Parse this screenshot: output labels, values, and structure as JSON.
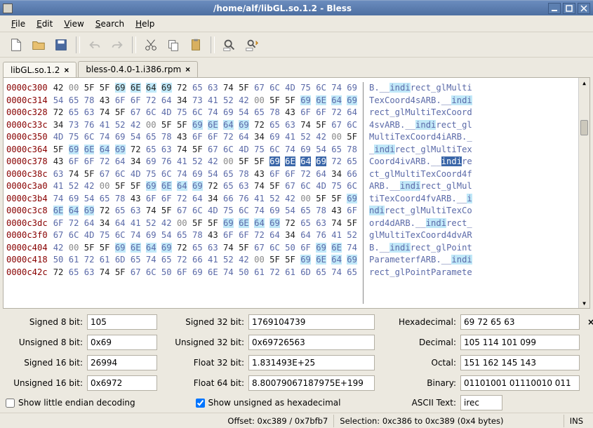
{
  "title": "/home/alf/libGL.so.1.2 - Bless",
  "menus": {
    "file": "File",
    "edit": "Edit",
    "view": "View",
    "search": "Search",
    "help": "Help"
  },
  "tabs": [
    {
      "label": "libGL.so.1.2",
      "closable": true,
      "active": true
    },
    {
      "label": "bless-0.4.0-1.i386.rpm",
      "closable": true,
      "active": false
    }
  ],
  "hex": {
    "offsets": [
      "0000c300",
      "0000c314",
      "0000c328",
      "0000c33c",
      "0000c350",
      "0000c364",
      "0000c378",
      "0000c38c",
      "0000c3a0",
      "0000c3b4",
      "0000c3c8",
      "0000c3dc",
      "0000c3f0",
      "0000c404",
      "0000c418",
      "0000c42c"
    ],
    "rows": [
      [
        [
          "42",
          1
        ],
        [
          "00",
          0
        ],
        [
          "5F",
          1
        ],
        [
          "5F",
          1
        ],
        [
          "69",
          1,
          "hl"
        ],
        [
          "6E",
          1,
          "hl"
        ],
        [
          "64",
          1,
          "hl"
        ],
        [
          "69",
          1,
          "hl"
        ],
        [
          "72",
          1
        ],
        [
          "65",
          2
        ],
        [
          "63",
          2
        ],
        [
          "74",
          1
        ],
        [
          "5F",
          1
        ],
        [
          "67",
          2
        ],
        [
          "6C",
          2
        ],
        [
          "4D",
          2
        ],
        [
          "75",
          2
        ],
        [
          "6C",
          2
        ],
        [
          "74",
          2
        ],
        [
          "69",
          2
        ]
      ],
      [
        [
          "54",
          2
        ],
        [
          "65",
          2
        ],
        [
          "78",
          2
        ],
        [
          "43",
          1
        ],
        [
          "6F",
          2
        ],
        [
          "6F",
          2
        ],
        [
          "72",
          2
        ],
        [
          "64",
          2
        ],
        [
          "34",
          1
        ],
        [
          "73",
          2
        ],
        [
          "41",
          2
        ],
        [
          "52",
          2
        ],
        [
          "42",
          2
        ],
        [
          "00",
          0
        ],
        [
          "5F",
          1
        ],
        [
          "5F",
          1
        ],
        [
          "69",
          2,
          "hl"
        ],
        [
          "6E",
          2,
          "hl"
        ],
        [
          "64",
          2,
          "hl"
        ],
        [
          "69",
          2,
          "hl"
        ]
      ],
      [
        [
          "72",
          1
        ],
        [
          "65",
          2
        ],
        [
          "63",
          2
        ],
        [
          "74",
          1
        ],
        [
          "5F",
          1
        ],
        [
          "67",
          2
        ],
        [
          "6C",
          2
        ],
        [
          "4D",
          2
        ],
        [
          "75",
          2
        ],
        [
          "6C",
          2
        ],
        [
          "74",
          2
        ],
        [
          "69",
          2
        ],
        [
          "54",
          2
        ],
        [
          "65",
          2
        ],
        [
          "78",
          2
        ],
        [
          "43",
          1
        ],
        [
          "6F",
          2
        ],
        [
          "6F",
          2
        ],
        [
          "72",
          2
        ],
        [
          "64",
          2
        ]
      ],
      [
        [
          "34",
          1
        ],
        [
          "73",
          2
        ],
        [
          "76",
          2
        ],
        [
          "41",
          2
        ],
        [
          "52",
          2
        ],
        [
          "42",
          2
        ],
        [
          "00",
          0
        ],
        [
          "5F",
          1
        ],
        [
          "5F",
          1
        ],
        [
          "69",
          2,
          "hl"
        ],
        [
          "6E",
          2,
          "hl"
        ],
        [
          "64",
          2,
          "hl"
        ],
        [
          "69",
          2,
          "hl"
        ],
        [
          "72",
          1
        ],
        [
          "65",
          2
        ],
        [
          "63",
          2
        ],
        [
          "74",
          1
        ],
        [
          "5F",
          1
        ],
        [
          "67",
          2
        ],
        [
          "6C",
          2
        ]
      ],
      [
        [
          "4D",
          2
        ],
        [
          "75",
          2
        ],
        [
          "6C",
          2
        ],
        [
          "74",
          2
        ],
        [
          "69",
          2
        ],
        [
          "54",
          2
        ],
        [
          "65",
          2
        ],
        [
          "78",
          2
        ],
        [
          "43",
          1
        ],
        [
          "6F",
          2
        ],
        [
          "6F",
          2
        ],
        [
          "72",
          2
        ],
        [
          "64",
          2
        ],
        [
          "34",
          1
        ],
        [
          "69",
          2
        ],
        [
          "41",
          2
        ],
        [
          "52",
          2
        ],
        [
          "42",
          2
        ],
        [
          "00",
          0
        ],
        [
          "5F",
          1
        ]
      ],
      [
        [
          "5F",
          1
        ],
        [
          "69",
          2,
          "hl"
        ],
        [
          "6E",
          2,
          "hl"
        ],
        [
          "64",
          2,
          "hl"
        ],
        [
          "69",
          2,
          "hl"
        ],
        [
          "72",
          1
        ],
        [
          "65",
          2
        ],
        [
          "63",
          2
        ],
        [
          "74",
          1
        ],
        [
          "5F",
          1
        ],
        [
          "67",
          2
        ],
        [
          "6C",
          2
        ],
        [
          "4D",
          2
        ],
        [
          "75",
          2
        ],
        [
          "6C",
          2
        ],
        [
          "74",
          2
        ],
        [
          "69",
          2
        ],
        [
          "54",
          2
        ],
        [
          "65",
          2
        ],
        [
          "78",
          2
        ]
      ],
      [
        [
          "43",
          1
        ],
        [
          "6F",
          2
        ],
        [
          "6F",
          2
        ],
        [
          "72",
          2
        ],
        [
          "64",
          2
        ],
        [
          "34",
          1
        ],
        [
          "69",
          2
        ],
        [
          "76",
          2
        ],
        [
          "41",
          2
        ],
        [
          "52",
          2
        ],
        [
          "42",
          2
        ],
        [
          "00",
          0
        ],
        [
          "5F",
          1
        ],
        [
          "5F",
          1
        ],
        [
          "69",
          2,
          "sel"
        ],
        [
          "6E",
          2,
          "sel"
        ],
        [
          "64",
          2,
          "sel"
        ],
        [
          "69",
          2,
          "sel"
        ],
        [
          "72",
          2
        ],
        [
          "65",
          2
        ]
      ],
      [
        [
          "63",
          2
        ],
        [
          "74",
          1
        ],
        [
          "5F",
          1
        ],
        [
          "67",
          2
        ],
        [
          "6C",
          2
        ],
        [
          "4D",
          2
        ],
        [
          "75",
          2
        ],
        [
          "6C",
          2
        ],
        [
          "74",
          2
        ],
        [
          "69",
          2
        ],
        [
          "54",
          2
        ],
        [
          "65",
          2
        ],
        [
          "78",
          2
        ],
        [
          "43",
          1
        ],
        [
          "6F",
          2
        ],
        [
          "6F",
          2
        ],
        [
          "72",
          2
        ],
        [
          "64",
          2
        ],
        [
          "34",
          1
        ],
        [
          "66",
          2
        ]
      ],
      [
        [
          "41",
          2
        ],
        [
          "52",
          2
        ],
        [
          "42",
          2
        ],
        [
          "00",
          0
        ],
        [
          "5F",
          1
        ],
        [
          "5F",
          1
        ],
        [
          "69",
          2,
          "hl"
        ],
        [
          "6E",
          2,
          "hl"
        ],
        [
          "64",
          2,
          "hl"
        ],
        [
          "69",
          2,
          "hl"
        ],
        [
          "72",
          1
        ],
        [
          "65",
          2
        ],
        [
          "63",
          2
        ],
        [
          "74",
          1
        ],
        [
          "5F",
          1
        ],
        [
          "67",
          2
        ],
        [
          "6C",
          2
        ],
        [
          "4D",
          2
        ],
        [
          "75",
          2
        ],
        [
          "6C",
          2
        ]
      ],
      [
        [
          "74",
          2
        ],
        [
          "69",
          2
        ],
        [
          "54",
          2
        ],
        [
          "65",
          2
        ],
        [
          "78",
          2
        ],
        [
          "43",
          1
        ],
        [
          "6F",
          2
        ],
        [
          "6F",
          2
        ],
        [
          "72",
          2
        ],
        [
          "64",
          2
        ],
        [
          "34",
          1
        ],
        [
          "66",
          2
        ],
        [
          "76",
          2
        ],
        [
          "41",
          2
        ],
        [
          "52",
          2
        ],
        [
          "42",
          2
        ],
        [
          "00",
          0
        ],
        [
          "5F",
          1
        ],
        [
          "5F",
          1
        ],
        [
          "69",
          2,
          "hl"
        ]
      ],
      [
        [
          "6E",
          2,
          "hl"
        ],
        [
          "64",
          2,
          "hl"
        ],
        [
          "69",
          2,
          "hl"
        ],
        [
          "72",
          1
        ],
        [
          "65",
          2
        ],
        [
          "63",
          2
        ],
        [
          "74",
          1
        ],
        [
          "5F",
          1
        ],
        [
          "67",
          2
        ],
        [
          "6C",
          2
        ],
        [
          "4D",
          2
        ],
        [
          "75",
          2
        ],
        [
          "6C",
          2
        ],
        [
          "74",
          2
        ],
        [
          "69",
          2
        ],
        [
          "54",
          2
        ],
        [
          "65",
          2
        ],
        [
          "78",
          2
        ],
        [
          "43",
          1
        ],
        [
          "6F",
          2
        ]
      ],
      [
        [
          "6F",
          2
        ],
        [
          "72",
          2
        ],
        [
          "64",
          2
        ],
        [
          "34",
          1
        ],
        [
          "64",
          2
        ],
        [
          "41",
          2
        ],
        [
          "52",
          2
        ],
        [
          "42",
          2
        ],
        [
          "00",
          0
        ],
        [
          "5F",
          1
        ],
        [
          "5F",
          1
        ],
        [
          "69",
          2,
          "hl"
        ],
        [
          "6E",
          2,
          "hl"
        ],
        [
          "64",
          2,
          "hl"
        ],
        [
          "69",
          2,
          "hl"
        ],
        [
          "72",
          1
        ],
        [
          "65",
          2
        ],
        [
          "63",
          2
        ],
        [
          "74",
          1
        ],
        [
          "5F",
          1
        ]
      ],
      [
        [
          "67",
          2
        ],
        [
          "6C",
          2
        ],
        [
          "4D",
          2
        ],
        [
          "75",
          2
        ],
        [
          "6C",
          2
        ],
        [
          "74",
          2
        ],
        [
          "69",
          2
        ],
        [
          "54",
          2
        ],
        [
          "65",
          2
        ],
        [
          "78",
          2
        ],
        [
          "43",
          1
        ],
        [
          "6F",
          2
        ],
        [
          "6F",
          2
        ],
        [
          "72",
          2
        ],
        [
          "64",
          2
        ],
        [
          "34",
          1
        ],
        [
          "64",
          2
        ],
        [
          "76",
          2
        ],
        [
          "41",
          2
        ],
        [
          "52",
          2
        ]
      ],
      [
        [
          "42",
          2
        ],
        [
          "00",
          0
        ],
        [
          "5F",
          1
        ],
        [
          "5F",
          1
        ],
        [
          "69",
          2,
          "hl"
        ],
        [
          "6E",
          2,
          "hl"
        ],
        [
          "64",
          2,
          "hl"
        ],
        [
          "69",
          2,
          "hl"
        ],
        [
          "72",
          1
        ],
        [
          "65",
          2
        ],
        [
          "63",
          2
        ],
        [
          "74",
          1
        ],
        [
          "5F",
          1
        ],
        [
          "67",
          2
        ],
        [
          "6C",
          2
        ],
        [
          "50",
          2
        ],
        [
          "6F",
          2
        ],
        [
          "69",
          2,
          "hl"
        ],
        [
          "6E",
          2,
          "hl"
        ],
        [
          "74",
          2
        ]
      ],
      [
        [
          "50",
          2
        ],
        [
          "61",
          2
        ],
        [
          "72",
          2
        ],
        [
          "61",
          2
        ],
        [
          "6D",
          2
        ],
        [
          "65",
          2
        ],
        [
          "74",
          2
        ],
        [
          "65",
          2
        ],
        [
          "72",
          2
        ],
        [
          "66",
          2
        ],
        [
          "41",
          2
        ],
        [
          "52",
          2
        ],
        [
          "42",
          2
        ],
        [
          "00",
          0
        ],
        [
          "5F",
          1
        ],
        [
          "5F",
          1
        ],
        [
          "69",
          2,
          "hl"
        ],
        [
          "6E",
          2,
          "hl"
        ],
        [
          "64",
          2,
          "hl"
        ],
        [
          "69",
          2,
          "hl"
        ]
      ],
      [
        [
          "72",
          1
        ],
        [
          "65",
          2
        ],
        [
          "63",
          2
        ],
        [
          "74",
          1
        ],
        [
          "5F",
          1
        ],
        [
          "67",
          2
        ],
        [
          "6C",
          2
        ],
        [
          "50",
          2
        ],
        [
          "6F",
          2
        ],
        [
          "69",
          2
        ],
        [
          "6E",
          2
        ],
        [
          "74",
          2
        ],
        [
          "50",
          2
        ],
        [
          "61",
          2
        ],
        [
          "72",
          2
        ],
        [
          "61",
          2
        ],
        [
          "6D",
          2
        ],
        [
          "65",
          2
        ],
        [
          "74",
          2
        ],
        [
          "65",
          2
        ]
      ]
    ],
    "ascii": [
      "B.__<hl>indi</hl>rect_glMulti",
      "TexCoord4sARB.__<hl>indi</hl>",
      "rect_glMultiTexCoord",
      "4svARB.__<hl>indi</hl>rect_gl",
      "MultiTexCoord4iARB._",
      "_<hl>indi</hl>rect_glMultiTex",
      "Coord4ivARB.__<sel>indi</sel>re",
      "ct_glMultiTexCoord4f",
      "ARB.__<hl>indi</hl>rect_glMul",
      "tiTexCoord4fvARB.__<hl>i</hl>",
      "<hl>ndi</hl>rect_glMultiTexCo",
      "ord4dARB.__<hl>indi</hl>rect_",
      "glMultiTexCoord4dvAR",
      "B.__<hl>indi</hl>rect_glPoint",
      "ParameterfARB.__<hl>indi</hl>",
      "rect_glPointParamete"
    ]
  },
  "inspector": {
    "labels": {
      "s8": "Signed 8 bit:",
      "u8": "Unsigned 8 bit:",
      "s16": "Signed 16 bit:",
      "u16": "Unsigned 16 bit:",
      "s32": "Signed 32 bit:",
      "u32": "Unsigned 32 bit:",
      "f32": "Float 32 bit:",
      "f64": "Float 64 bit:",
      "hex": "Hexadecimal:",
      "dec": "Decimal:",
      "oct": "Octal:",
      "bin": "Binary:",
      "ascii": "ASCII Text:",
      "little_endian": "Show little endian decoding",
      "unsigned_hex": "Show unsigned as hexadecimal"
    },
    "values": {
      "s8": "105",
      "u8": "0x69",
      "s16": "26994",
      "u16": "0x6972",
      "s32": "1769104739",
      "u32": "0x69726563",
      "f32": "1.831493E+25",
      "f64": "8.80079067187975E+199",
      "hex": "69 72 65 63",
      "dec": "105 114 101 099",
      "oct": "151 162 145 143",
      "bin": "01101001 01110010 011",
      "ascii": "irec"
    },
    "little_endian_checked": false,
    "unsigned_hex_checked": true
  },
  "status": {
    "offset": "Offset: 0xc389 / 0x7bfb7",
    "selection": "Selection: 0xc386 to 0xc389 (0x4 bytes)",
    "ins": "INS"
  }
}
